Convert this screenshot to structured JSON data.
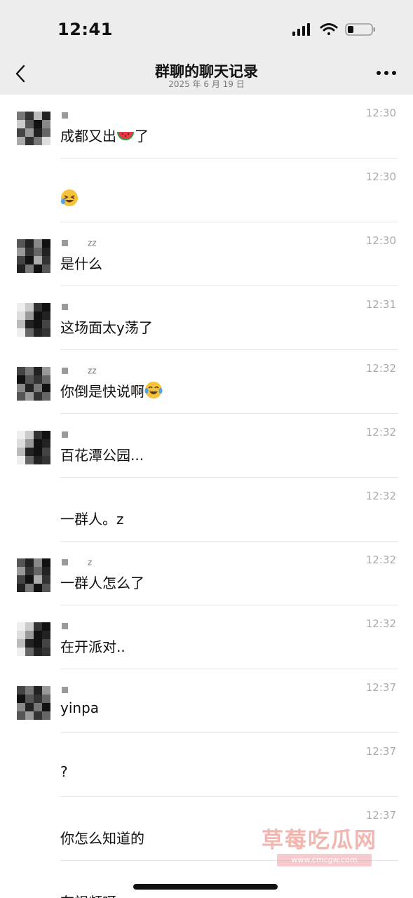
{
  "status_bar": {
    "time": "12:41",
    "battery_level": 0.25
  },
  "nav": {
    "title": "群聊的聊天记录",
    "subtitle": "2025 年 6 月 19 日",
    "back_icon": "chevron-left-icon",
    "more_icon": "ellipsis-icon"
  },
  "messages": [
    {
      "avatar": "a",
      "name_suffix": "",
      "time": "12:30",
      "text": "成都又出",
      "emoji": "watermelon",
      "text_after": "了"
    },
    {
      "avatar": "",
      "name_suffix": "",
      "time": "12:30",
      "text": "",
      "emoji": "laughing-face",
      "text_after": ""
    },
    {
      "avatar": "b",
      "name_suffix": "zz",
      "time": "12:30",
      "text": "是什么",
      "emoji": "",
      "text_after": ""
    },
    {
      "avatar": "c",
      "name_suffix": "",
      "time": "12:31",
      "text": "这场面太y荡了",
      "emoji": "",
      "text_after": ""
    },
    {
      "avatar": "d",
      "name_suffix": "zz",
      "time": "12:32",
      "text": "你倒是快说啊",
      "emoji": "tears-of-joy",
      "text_after": ""
    },
    {
      "avatar": "c",
      "name_suffix": "",
      "time": "12:32",
      "text": "百花潭公园...",
      "emoji": "",
      "text_after": ""
    },
    {
      "avatar": "",
      "name_suffix": "",
      "time": "12:32",
      "text": "一群人。z",
      "emoji": "",
      "text_after": ""
    },
    {
      "avatar": "b",
      "name_suffix": "z",
      "time": "12:32",
      "text": "一群人怎么了",
      "emoji": "",
      "text_after": ""
    },
    {
      "avatar": "c",
      "name_suffix": "",
      "time": "12:32",
      "text": "在开派对..",
      "emoji": "",
      "text_after": ""
    },
    {
      "avatar": "d",
      "name_suffix": "",
      "time": "12:37",
      "text": "yinpa",
      "emoji": "",
      "text_after": ""
    },
    {
      "avatar": "",
      "name_suffix": "",
      "time": "12:37",
      "text": "?",
      "emoji": "",
      "text_after": ""
    },
    {
      "avatar": "",
      "name_suffix": "",
      "time": "12:37",
      "text": "你怎么知道的",
      "emoji": "",
      "text_after": ""
    },
    {
      "avatar": "",
      "name_suffix": "",
      "time": "",
      "text": "有视频呀",
      "emoji": "",
      "text_after": ""
    }
  ],
  "watermark": {
    "text": "草莓吃瓜网",
    "url": "www.cmcgw.com"
  }
}
